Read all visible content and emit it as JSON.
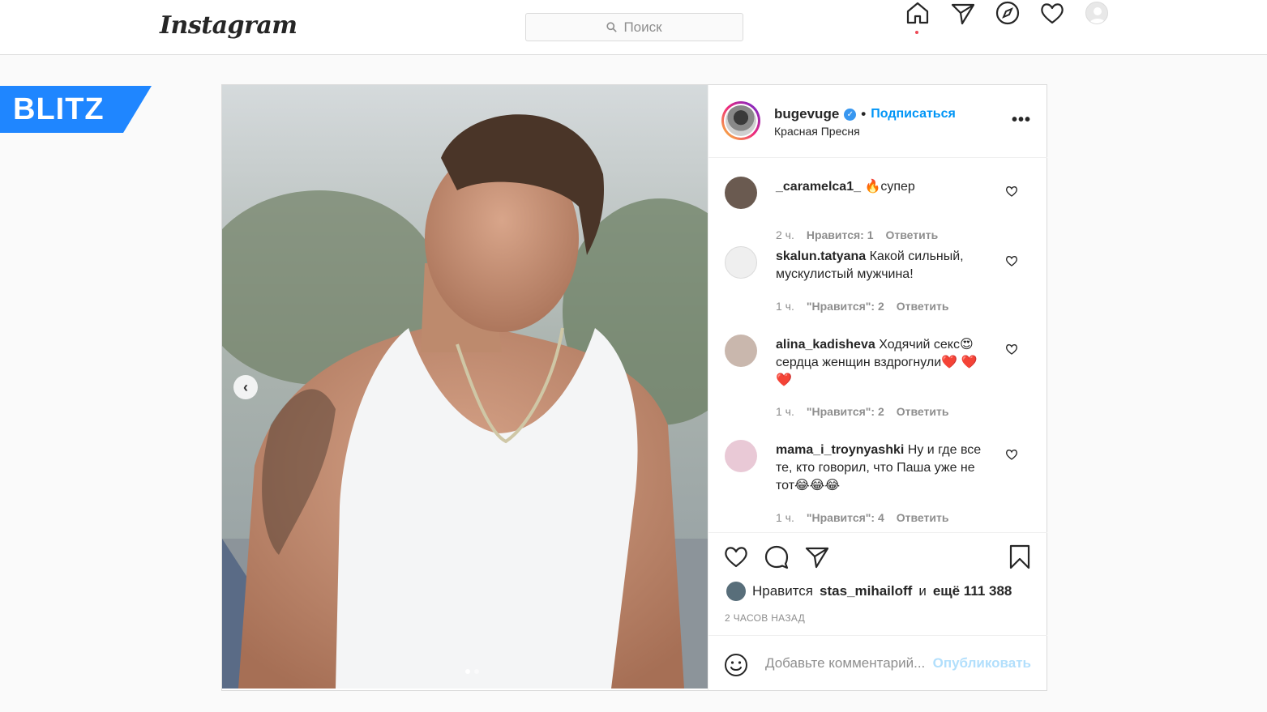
{
  "nav": {
    "logo": "Instagram",
    "search_placeholder": "Поиск",
    "icons": [
      "home-icon",
      "direct-icon",
      "explore-icon",
      "activity-heart-icon",
      "profile-avatar"
    ]
  },
  "badge": {
    "text": "BLITZ",
    "color": "#1f86ff"
  },
  "post": {
    "author": "bugevuge",
    "follow": "Подписаться",
    "location": "Красная Пресня",
    "more": "•••",
    "comments": [
      {
        "user": "_caramelca1_",
        "text": "🔥супер",
        "time": "2 ч.",
        "likes": "Нравится: 1",
        "reply": "Ответить"
      },
      {
        "user": "skalun.tatyana",
        "text": "Какой сильный, мускулистый мужчина!",
        "time": "1 ч.",
        "likes": "\"Нравится\": 2",
        "reply": "Ответить"
      },
      {
        "user": "alina_kadisheva",
        "text": "Ходячий секс😍 сердца женщин вздрогнули❤️ ❤️ ❤️",
        "time": "1 ч.",
        "likes": "\"Нравится\": 2",
        "reply": "Ответить"
      },
      {
        "user": "mama_i_troynyashki",
        "text": "Ну и где все те, кто говорил, что Паша уже не тот😂😂😂",
        "time": "1 ч.",
        "likes": "\"Нравится\": 4",
        "reply": "Ответить"
      }
    ],
    "likes_prefix": "Нравится",
    "likes_user": "stas_mihailoff",
    "likes_and": "и",
    "likes_count": "ещё 111 388",
    "time_ago": "2 часов назад",
    "add_comment_placeholder": "Добавьте комментарий...",
    "publish": "Опубликовать"
  }
}
